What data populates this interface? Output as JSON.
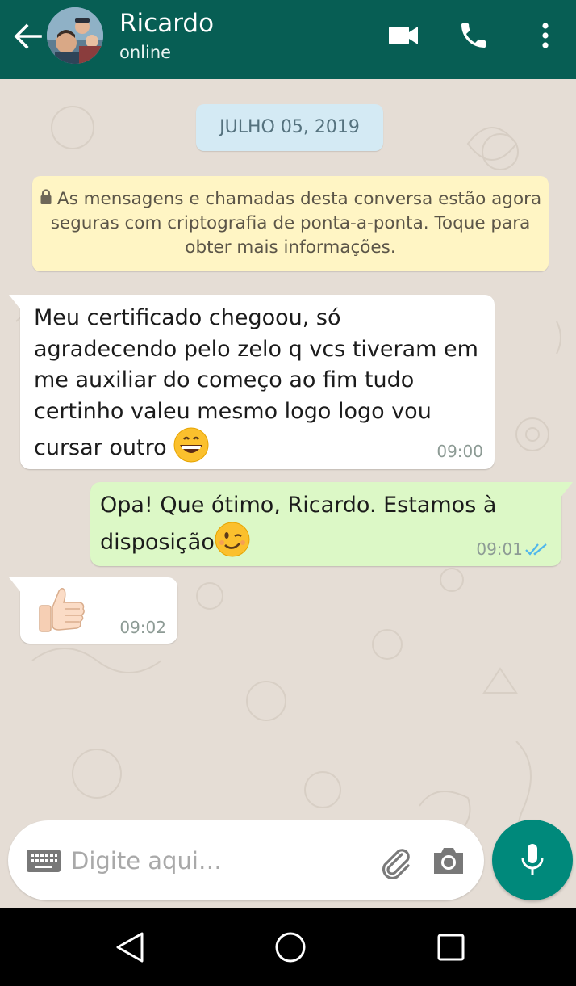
{
  "header": {
    "contact_name": "Ricardo",
    "status": "online",
    "icons": [
      "back-arrow-icon",
      "avatar",
      "video-camera-icon",
      "phone-icon",
      "more-vert-icon"
    ],
    "background_color": "#075e54"
  },
  "chat": {
    "date_chip": "JULHO 05, 2019",
    "encryption_notice": "As mensagens e chamadas desta conversa estão agora seguras com criptografia de ponta-a-ponta. Toque para obter mais informações.",
    "messages": [
      {
        "direction": "incoming",
        "text": "Meu certificado chegoou, só agradecendo pelo zelo q vcs tiveram em me auxiliar do começo ao fim tudo certinho valeu  mesmo logo logo vou cursar outro",
        "emoji": "grinning-face-icon",
        "time": "09:00"
      },
      {
        "direction": "outgoing",
        "text": "Opa! Que ótimo, Ricardo. Estamos à disposição",
        "emoji": "winking-face-icon",
        "time": "09:01",
        "status": "read-double-tick-icon"
      },
      {
        "direction": "incoming",
        "emoji": "thumbs-up-icon",
        "time": "09:02"
      }
    ],
    "bubble_colors": {
      "incoming": "#ffffff",
      "outgoing": "#dcf8c6"
    }
  },
  "composer": {
    "placeholder": "Digite aqui…",
    "value": "",
    "icons": [
      "keyboard-icon",
      "paperclip-icon",
      "camera-icon",
      "mic-icon"
    ],
    "mic_button_color": "#00897b"
  },
  "system_nav": {
    "icons": [
      "nav-back-icon",
      "nav-home-icon",
      "nav-recents-icon"
    ]
  }
}
